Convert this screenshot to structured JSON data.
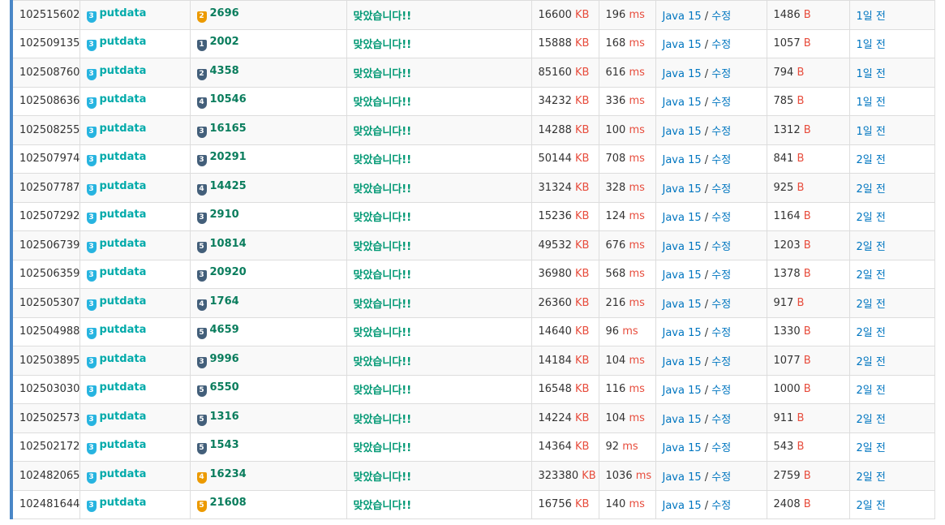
{
  "submissions": [
    {
      "id": "102515602",
      "user": "putdata",
      "user_tier": "3",
      "problem_tier": "2",
      "problem_tier_color": "gold",
      "problem": "2696",
      "result": "맞았습니다!!",
      "memory": "16600",
      "memory_unit": "KB",
      "time": "196",
      "time_unit": "ms",
      "language": "Java 15",
      "edit": "수정",
      "code_length": "1486",
      "length_unit": "B",
      "submitted": "1일 전"
    },
    {
      "id": "102509135",
      "user": "putdata",
      "user_tier": "3",
      "problem_tier": "1",
      "problem_tier_color": "silver",
      "problem": "2002",
      "result": "맞았습니다!!",
      "memory": "15888",
      "memory_unit": "KB",
      "time": "168",
      "time_unit": "ms",
      "language": "Java 15",
      "edit": "수정",
      "code_length": "1057",
      "length_unit": "B",
      "submitted": "1일 전"
    },
    {
      "id": "102508760",
      "user": "putdata",
      "user_tier": "3",
      "problem_tier": "2",
      "problem_tier_color": "silver",
      "problem": "4358",
      "result": "맞았습니다!!",
      "memory": "85160",
      "memory_unit": "KB",
      "time": "616",
      "time_unit": "ms",
      "language": "Java 15",
      "edit": "수정",
      "code_length": "794",
      "length_unit": "B",
      "submitted": "1일 전"
    },
    {
      "id": "102508636",
      "user": "putdata",
      "user_tier": "3",
      "problem_tier": "4",
      "problem_tier_color": "silver",
      "problem": "10546",
      "result": "맞았습니다!!",
      "memory": "34232",
      "memory_unit": "KB",
      "time": "336",
      "time_unit": "ms",
      "language": "Java 15",
      "edit": "수정",
      "code_length": "785",
      "length_unit": "B",
      "submitted": "1일 전"
    },
    {
      "id": "102508255",
      "user": "putdata",
      "user_tier": "3",
      "problem_tier": "3",
      "problem_tier_color": "silver",
      "problem": "16165",
      "result": "맞았습니다!!",
      "memory": "14288",
      "memory_unit": "KB",
      "time": "100",
      "time_unit": "ms",
      "language": "Java 15",
      "edit": "수정",
      "code_length": "1312",
      "length_unit": "B",
      "submitted": "1일 전"
    },
    {
      "id": "102507974",
      "user": "putdata",
      "user_tier": "3",
      "problem_tier": "3",
      "problem_tier_color": "silver",
      "problem": "20291",
      "result": "맞았습니다!!",
      "memory": "50144",
      "memory_unit": "KB",
      "time": "708",
      "time_unit": "ms",
      "language": "Java 15",
      "edit": "수정",
      "code_length": "841",
      "length_unit": "B",
      "submitted": "2일 전"
    },
    {
      "id": "102507787",
      "user": "putdata",
      "user_tier": "3",
      "problem_tier": "4",
      "problem_tier_color": "silver",
      "problem": "14425",
      "result": "맞았습니다!!",
      "memory": "31324",
      "memory_unit": "KB",
      "time": "328",
      "time_unit": "ms",
      "language": "Java 15",
      "edit": "수정",
      "code_length": "925",
      "length_unit": "B",
      "submitted": "2일 전"
    },
    {
      "id": "102507292",
      "user": "putdata",
      "user_tier": "3",
      "problem_tier": "3",
      "problem_tier_color": "silver",
      "problem": "2910",
      "result": "맞았습니다!!",
      "memory": "15236",
      "memory_unit": "KB",
      "time": "124",
      "time_unit": "ms",
      "language": "Java 15",
      "edit": "수정",
      "code_length": "1164",
      "length_unit": "B",
      "submitted": "2일 전"
    },
    {
      "id": "102506739",
      "user": "putdata",
      "user_tier": "3",
      "problem_tier": "5",
      "problem_tier_color": "silver",
      "problem": "10814",
      "result": "맞았습니다!!",
      "memory": "49532",
      "memory_unit": "KB",
      "time": "676",
      "time_unit": "ms",
      "language": "Java 15",
      "edit": "수정",
      "code_length": "1203",
      "length_unit": "B",
      "submitted": "2일 전"
    },
    {
      "id": "102506359",
      "user": "putdata",
      "user_tier": "3",
      "problem_tier": "3",
      "problem_tier_color": "silver",
      "problem": "20920",
      "result": "맞았습니다!!",
      "memory": "36980",
      "memory_unit": "KB",
      "time": "568",
      "time_unit": "ms",
      "language": "Java 15",
      "edit": "수정",
      "code_length": "1378",
      "length_unit": "B",
      "submitted": "2일 전"
    },
    {
      "id": "102505307",
      "user": "putdata",
      "user_tier": "3",
      "problem_tier": "4",
      "problem_tier_color": "silver",
      "problem": "1764",
      "result": "맞았습니다!!",
      "memory": "26360",
      "memory_unit": "KB",
      "time": "216",
      "time_unit": "ms",
      "language": "Java 15",
      "edit": "수정",
      "code_length": "917",
      "length_unit": "B",
      "submitted": "2일 전"
    },
    {
      "id": "102504988",
      "user": "putdata",
      "user_tier": "3",
      "problem_tier": "5",
      "problem_tier_color": "silver",
      "problem": "4659",
      "result": "맞았습니다!!",
      "memory": "14640",
      "memory_unit": "KB",
      "time": "96",
      "time_unit": "ms",
      "language": "Java 15",
      "edit": "수정",
      "code_length": "1330",
      "length_unit": "B",
      "submitted": "2일 전"
    },
    {
      "id": "102503895",
      "user": "putdata",
      "user_tier": "3",
      "problem_tier": "3",
      "problem_tier_color": "silver",
      "problem": "9996",
      "result": "맞았습니다!!",
      "memory": "14184",
      "memory_unit": "KB",
      "time": "104",
      "time_unit": "ms",
      "language": "Java 15",
      "edit": "수정",
      "code_length": "1077",
      "length_unit": "B",
      "submitted": "2일 전"
    },
    {
      "id": "102503030",
      "user": "putdata",
      "user_tier": "3",
      "problem_tier": "5",
      "problem_tier_color": "silver",
      "problem": "6550",
      "result": "맞았습니다!!",
      "memory": "16548",
      "memory_unit": "KB",
      "time": "116",
      "time_unit": "ms",
      "language": "Java 15",
      "edit": "수정",
      "code_length": "1000",
      "length_unit": "B",
      "submitted": "2일 전"
    },
    {
      "id": "102502573",
      "user": "putdata",
      "user_tier": "3",
      "problem_tier": "5",
      "problem_tier_color": "silver",
      "problem": "1316",
      "result": "맞았습니다!!",
      "memory": "14224",
      "memory_unit": "KB",
      "time": "104",
      "time_unit": "ms",
      "language": "Java 15",
      "edit": "수정",
      "code_length": "911",
      "length_unit": "B",
      "submitted": "2일 전"
    },
    {
      "id": "102502172",
      "user": "putdata",
      "user_tier": "3",
      "problem_tier": "5",
      "problem_tier_color": "silver",
      "problem": "1543",
      "result": "맞았습니다!!",
      "memory": "14364",
      "memory_unit": "KB",
      "time": "92",
      "time_unit": "ms",
      "language": "Java 15",
      "edit": "수정",
      "code_length": "543",
      "length_unit": "B",
      "submitted": "2일 전"
    },
    {
      "id": "102482065",
      "user": "putdata",
      "user_tier": "3",
      "problem_tier": "4",
      "problem_tier_color": "gold",
      "problem": "16234",
      "result": "맞았습니다!!",
      "memory": "323380",
      "memory_unit": "KB",
      "time": "1036",
      "time_unit": "ms",
      "language": "Java 15",
      "edit": "수정",
      "code_length": "2759",
      "length_unit": "B",
      "submitted": "2일 전"
    },
    {
      "id": "102481644",
      "user": "putdata",
      "user_tier": "3",
      "problem_tier": "5",
      "problem_tier_color": "gold",
      "problem": "21608",
      "result": "맞았습니다!!",
      "memory": "16756",
      "memory_unit": "KB",
      "time": "140",
      "time_unit": "ms",
      "language": "Java 15",
      "edit": "수정",
      "code_length": "2408",
      "length_unit": "B",
      "submitted": "2일 전"
    }
  ]
}
